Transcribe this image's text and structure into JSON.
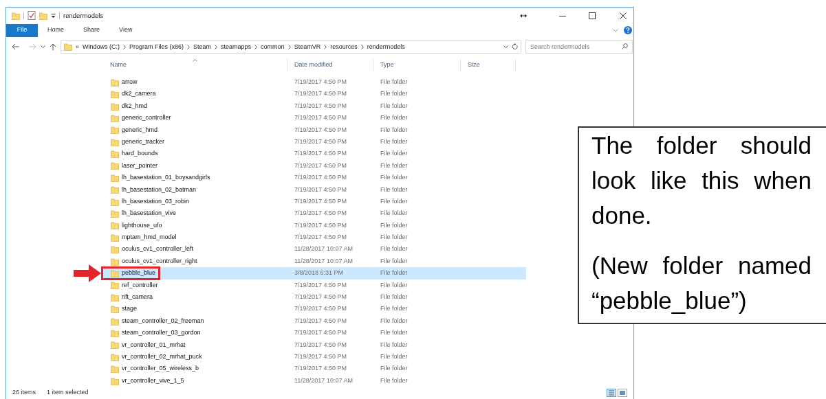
{
  "window": {
    "title": "rendermodels"
  },
  "ribbon": {
    "tabs": [
      {
        "label": "File",
        "selected": true
      },
      {
        "label": "Home",
        "selected": false
      },
      {
        "label": "Share",
        "selected": false
      },
      {
        "label": "View",
        "selected": false
      }
    ]
  },
  "address": {
    "overflow": "«",
    "crumbs": [
      "Windows (C:)",
      "Program Files (x86)",
      "Steam",
      "steamapps",
      "common",
      "SteamVR",
      "resources",
      "rendermodels"
    ]
  },
  "search": {
    "placeholder": "Search rendermodels"
  },
  "columns": [
    {
      "label": "Name",
      "sorted": true
    },
    {
      "label": "Date modified",
      "sorted": false
    },
    {
      "label": "Type",
      "sorted": false
    },
    {
      "label": "Size",
      "sorted": false
    }
  ],
  "rows": [
    {
      "name": "arrow",
      "date": "7/19/2017 4:50 PM",
      "type": "File folder",
      "selected": false,
      "marked": false
    },
    {
      "name": "dk2_camera",
      "date": "7/19/2017 4:50 PM",
      "type": "File folder",
      "selected": false,
      "marked": false
    },
    {
      "name": "dk2_hmd",
      "date": "7/19/2017 4:50 PM",
      "type": "File folder",
      "selected": false,
      "marked": false
    },
    {
      "name": "generic_controller",
      "date": "7/19/2017 4:50 PM",
      "type": "File folder",
      "selected": false,
      "marked": false
    },
    {
      "name": "generic_hmd",
      "date": "7/19/2017 4:50 PM",
      "type": "File folder",
      "selected": false,
      "marked": false
    },
    {
      "name": "generic_tracker",
      "date": "7/19/2017 4:50 PM",
      "type": "File folder",
      "selected": false,
      "marked": false
    },
    {
      "name": "hard_bounds",
      "date": "7/19/2017 4:50 PM",
      "type": "File folder",
      "selected": false,
      "marked": false
    },
    {
      "name": "laser_pointer",
      "date": "7/19/2017 4:50 PM",
      "type": "File folder",
      "selected": false,
      "marked": false
    },
    {
      "name": "lh_basestation_01_boysandgirls",
      "date": "7/19/2017 4:50 PM",
      "type": "File folder",
      "selected": false,
      "marked": false
    },
    {
      "name": "lh_basestation_02_batman",
      "date": "7/19/2017 4:50 PM",
      "type": "File folder",
      "selected": false,
      "marked": false
    },
    {
      "name": "lh_basestation_03_robin",
      "date": "7/19/2017 4:50 PM",
      "type": "File folder",
      "selected": false,
      "marked": false
    },
    {
      "name": "lh_basestation_vive",
      "date": "7/19/2017 4:50 PM",
      "type": "File folder",
      "selected": false,
      "marked": false
    },
    {
      "name": "lighthouse_ufo",
      "date": "7/19/2017 4:50 PM",
      "type": "File folder",
      "selected": false,
      "marked": false
    },
    {
      "name": "mptam_hmd_model",
      "date": "7/19/2017 4:50 PM",
      "type": "File folder",
      "selected": false,
      "marked": false
    },
    {
      "name": "oculus_cv1_controller_left",
      "date": "11/28/2017 10:07 AM",
      "type": "File folder",
      "selected": false,
      "marked": false
    },
    {
      "name": "oculus_cv1_controller_right",
      "date": "11/28/2017 10:07 AM",
      "type": "File folder",
      "selected": false,
      "marked": false
    },
    {
      "name": "pebble_blue",
      "date": "3/8/2018 6:31 PM",
      "type": "File folder",
      "selected": true,
      "marked": true
    },
    {
      "name": "ref_controller",
      "date": "7/19/2017 4:50 PM",
      "type": "File folder",
      "selected": false,
      "marked": false
    },
    {
      "name": "rift_camera",
      "date": "7/19/2017 4:50 PM",
      "type": "File folder",
      "selected": false,
      "marked": false
    },
    {
      "name": "stage",
      "date": "7/19/2017 4:50 PM",
      "type": "File folder",
      "selected": false,
      "marked": false
    },
    {
      "name": "steam_controller_02_freeman",
      "date": "7/19/2017 4:50 PM",
      "type": "File folder",
      "selected": false,
      "marked": false
    },
    {
      "name": "steam_controller_03_gordon",
      "date": "7/19/2017 4:50 PM",
      "type": "File folder",
      "selected": false,
      "marked": false
    },
    {
      "name": "vr_controller_01_mrhat",
      "date": "7/19/2017 4:50 PM",
      "type": "File folder",
      "selected": false,
      "marked": false
    },
    {
      "name": "vr_controller_02_mrhat_puck",
      "date": "7/19/2017 4:50 PM",
      "type": "File folder",
      "selected": false,
      "marked": false
    },
    {
      "name": "vr_controller_05_wireless_b",
      "date": "7/19/2017 4:50 PM",
      "type": "File folder",
      "selected": false,
      "marked": false
    },
    {
      "name": "vr_controller_vive_1_5",
      "date": "11/28/2017 10:07 AM",
      "type": "File folder",
      "selected": false,
      "marked": false
    }
  ],
  "status_bar": {
    "count": "26 items",
    "selection": "1 item selected"
  },
  "callout": {
    "paragraphs": [
      "The folder should look like this when done.",
      "(New folder named “pebble_blue”)"
    ]
  }
}
